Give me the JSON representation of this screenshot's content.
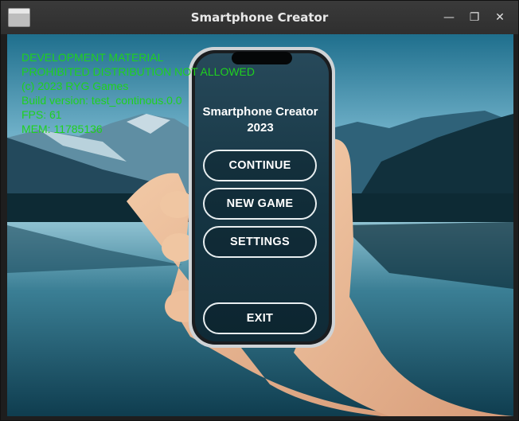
{
  "window": {
    "title": "Smartphone Creator",
    "minimize_glyph": "—",
    "maximize_glyph": "❐",
    "close_glyph": "✕"
  },
  "debug": {
    "line1": "DEVELOPMENT MATERIAL",
    "line2": "PROHIBITED DISTRIBUTION NOT ALLOWED",
    "line3": "(c) 2023 RYG Games",
    "line4": "Build version: test_continous.0.0",
    "line5": "FPS: 61",
    "line6": "MEM: 11785136",
    "color": "#1fd11f"
  },
  "game": {
    "title_line1": "Smartphone Creator",
    "title_line2": "2023"
  },
  "menu": {
    "continue": "CONTINUE",
    "new_game": "NEW GAME",
    "settings": "SETTINGS",
    "exit": "EXIT"
  }
}
